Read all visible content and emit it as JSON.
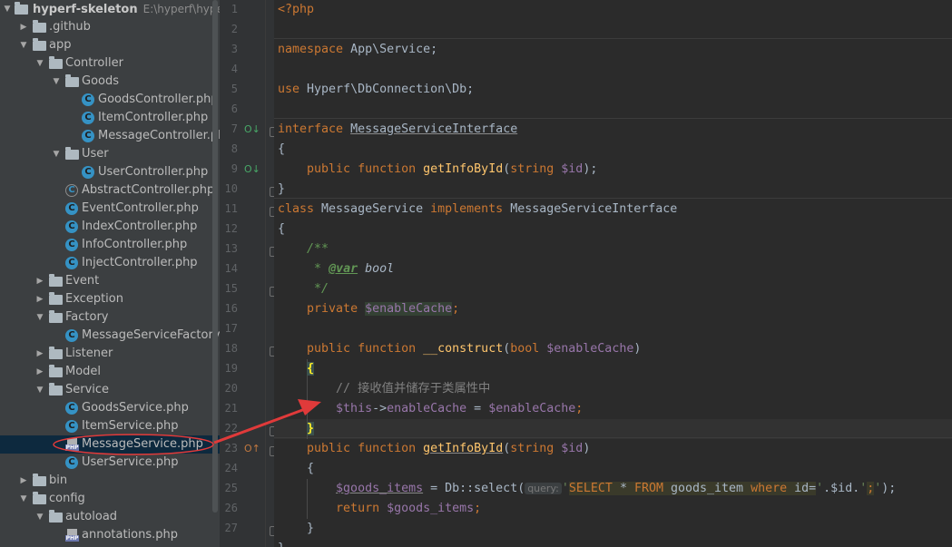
{
  "project_tree": {
    "root": {
      "name": "hyperf-skeleton",
      "path": "E:\\hyperf\\hyper-s"
    },
    "items": [
      {
        "label": ".github",
        "type": "folder",
        "depth": 1,
        "expanded": false
      },
      {
        "label": "app",
        "type": "folder",
        "depth": 1,
        "expanded": true
      },
      {
        "label": "Controller",
        "type": "folder",
        "depth": 2,
        "expanded": true
      },
      {
        "label": "Goods",
        "type": "folder",
        "depth": 3,
        "expanded": true
      },
      {
        "label": "GoodsController.php",
        "type": "class",
        "depth": 4
      },
      {
        "label": "ItemController.php",
        "type": "class",
        "depth": 4
      },
      {
        "label": "MessageController.php",
        "type": "class",
        "depth": 4
      },
      {
        "label": "User",
        "type": "folder",
        "depth": 3,
        "expanded": true
      },
      {
        "label": "UserController.php",
        "type": "class",
        "depth": 4
      },
      {
        "label": "AbstractController.php",
        "type": "abstract",
        "depth": 3
      },
      {
        "label": "EventController.php",
        "type": "class",
        "depth": 3
      },
      {
        "label": "IndexController.php",
        "type": "class",
        "depth": 3
      },
      {
        "label": "InfoController.php",
        "type": "class",
        "depth": 3
      },
      {
        "label": "InjectController.php",
        "type": "class",
        "depth": 3
      },
      {
        "label": "Event",
        "type": "folder",
        "depth": 2,
        "expanded": false
      },
      {
        "label": "Exception",
        "type": "folder",
        "depth": 2,
        "expanded": false
      },
      {
        "label": "Factory",
        "type": "folder",
        "depth": 2,
        "expanded": true
      },
      {
        "label": "MessageServiceFactory.php",
        "type": "class",
        "depth": 3
      },
      {
        "label": "Listener",
        "type": "folder",
        "depth": 2,
        "expanded": false
      },
      {
        "label": "Model",
        "type": "folder",
        "depth": 2,
        "expanded": false
      },
      {
        "label": "Service",
        "type": "folder",
        "depth": 2,
        "expanded": true
      },
      {
        "label": "GoodsService.php",
        "type": "class",
        "depth": 3
      },
      {
        "label": "ItemService.php",
        "type": "class",
        "depth": 3
      },
      {
        "label": "MessageService.php",
        "type": "php",
        "depth": 3,
        "selected": true
      },
      {
        "label": "UserService.php",
        "type": "class",
        "depth": 3
      },
      {
        "label": "bin",
        "type": "folder",
        "depth": 1,
        "expanded": false
      },
      {
        "label": "config",
        "type": "folder",
        "depth": 1,
        "expanded": true
      },
      {
        "label": "autoload",
        "type": "folder",
        "depth": 2,
        "expanded": true
      },
      {
        "label": "annotations.php",
        "type": "php",
        "depth": 3
      }
    ]
  },
  "editor": {
    "line_numbers": [
      "1",
      "2",
      "3",
      "4",
      "5",
      "6",
      "7",
      "8",
      "9",
      "10",
      "11",
      "12",
      "13",
      "14",
      "15",
      "16",
      "17",
      "18",
      "19",
      "20",
      "21",
      "22",
      "23",
      "24",
      "25",
      "26",
      "27"
    ],
    "code": {
      "l1": "<?php",
      "l3_kw": "namespace",
      "l3_rest": " App\\Service;",
      "l5_kw": "use",
      "l5_rest": " Hyperf\\DbConnection\\Db;",
      "l7_kw": "interface",
      "l7_name": "MessageServiceInterface",
      "open_brace": "{",
      "close_brace": "}",
      "l9_kw": "public function",
      "l9_fn": "getInfoById",
      "l9_p1": "(",
      "l9_type": "string",
      "l9_var": "$id",
      "l9_p2": ");",
      "l11_kw": "class",
      "l11_name": " MessageService ",
      "l11_kw2": "implements",
      "l11_rest": " MessageServiceInterface",
      "l13": "/**",
      "l14_star": " * ",
      "l14_tag": "@var",
      "l14_type": " bool",
      "l15": " */",
      "l16_kw": "private",
      "l16_var": "$enableCache",
      "l16_end": ";",
      "l18_kw": "public function",
      "l18_fn": "__construct",
      "l18_p1": "(",
      "l18_type": "bool",
      "l18_var": "$enableCache",
      "l18_p2": ")",
      "l20": "// 接收值并储存于类属性中",
      "l21_this": "$this",
      "l21_arrow": "->",
      "l21_prop": "enableCache",
      "l21_eq": " = ",
      "l21_var": "$enableCache",
      "l21_end": ";",
      "l23_kw": "public function",
      "l23_fn": "getInfoById",
      "l23_p1": "(",
      "l23_type": "string",
      "l23_var": "$id",
      "l23_p2": ")",
      "l25_var": "$goods_items",
      "l25_eq": " = Db::select(",
      "l25_hint": "query:",
      "l25_q1": "'",
      "l25_sel": "SELECT",
      "l25_star": " * ",
      "l25_from": "FROM",
      "l25_tbl": " goods_item ",
      "l25_where": "where",
      "l25_id": " id",
      "l25_eqs": "=",
      "l25_q2": "'",
      "l25_cat": ".$id.",
      "l25_q3": "'",
      "l25_semi": ";",
      "l25_q4": "'",
      "l25_end": ");",
      "l26_kw": "return",
      "l26_var": " $goods_items",
      "l26_end": ";"
    }
  },
  "colors": {
    "arrow": "#e03a3a",
    "selection": "#0d293e",
    "keyword": "#cc7832",
    "function": "#ffc66d",
    "variable": "#9876aa"
  }
}
